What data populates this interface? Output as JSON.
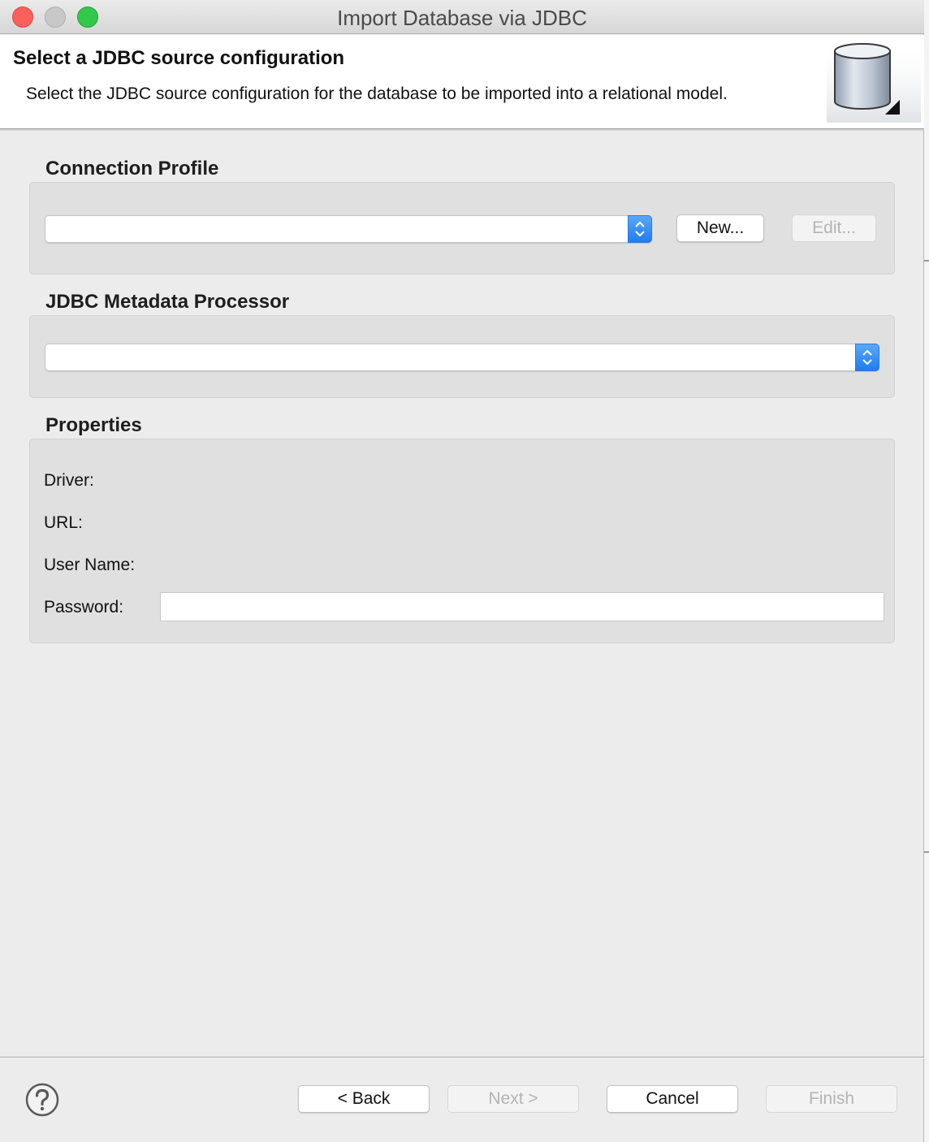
{
  "window": {
    "title": "Import Database via JDBC"
  },
  "header": {
    "title": "Select a JDBC source configuration",
    "description": "Select the JDBC source configuration for the database to be imported into a relational model.",
    "icon": "database-icon"
  },
  "connection_profile": {
    "label": "Connection Profile",
    "selected": "",
    "new_label": "New...",
    "edit_label": "Edit..."
  },
  "metadata_processor": {
    "label": "JDBC Metadata Processor",
    "selected": ""
  },
  "properties": {
    "label": "Properties",
    "driver_label": "Driver:",
    "url_label": "URL:",
    "user_name_label": "User Name:",
    "password_label": "Password:",
    "password_value": ""
  },
  "footer": {
    "help_icon": "help-icon",
    "back_label": "< Back",
    "next_label": "Next >",
    "cancel_label": "Cancel",
    "finish_label": "Finish"
  },
  "colors": {
    "accent": "#1f7cf2",
    "close": "#fc605c",
    "maximize": "#34c84a",
    "disabled_text": "#b4b4b4"
  }
}
